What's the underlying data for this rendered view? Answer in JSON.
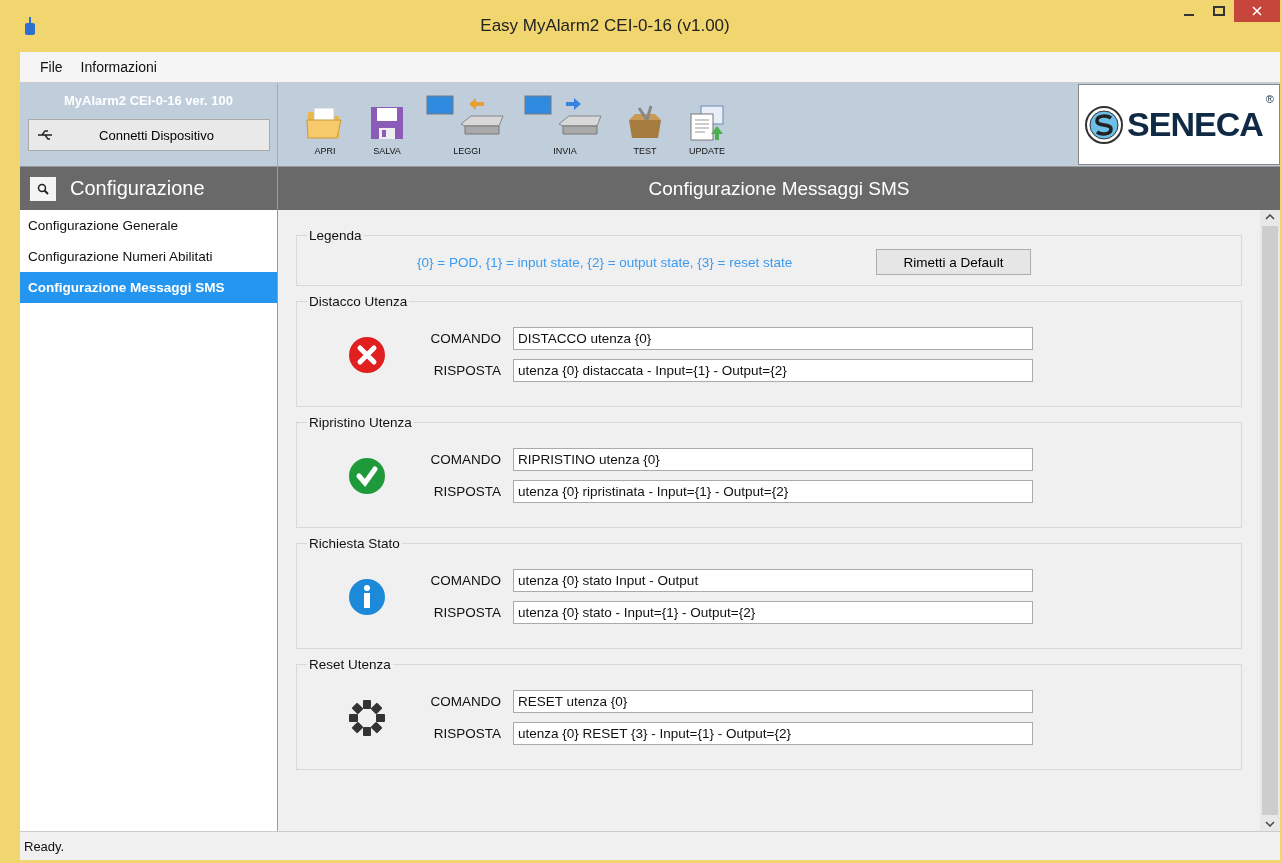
{
  "window": {
    "title": "Easy MyAlarm2 CEI-0-16 (v1.00)"
  },
  "menu": [
    {
      "label": "File"
    },
    {
      "label": "Informazioni"
    }
  ],
  "device": {
    "version": "MyAlarm2 CEI-0-16 ver. 100",
    "connect_button": "Connetti Dispositivo"
  },
  "toolbar": [
    {
      "kind": "open",
      "label": "APRI"
    },
    {
      "kind": "save",
      "label": "SALVA"
    },
    {
      "kind": "read",
      "label": "LEGGI"
    },
    {
      "kind": "send",
      "label": "INVIA"
    },
    {
      "kind": "test",
      "label": "TEST"
    },
    {
      "kind": "update",
      "label": "UPDATE"
    }
  ],
  "logo": {
    "text": "SENECA",
    "mark": "®"
  },
  "sidebar": {
    "title": "Configurazione",
    "items": [
      {
        "label": "Configurazione Generale",
        "selected": false
      },
      {
        "label": "Configurazione Numeri Abilitati",
        "selected": false
      },
      {
        "label": "Configurazione Messaggi SMS",
        "selected": true
      }
    ]
  },
  "page_title": "Configurazione Messaggi SMS",
  "legend": {
    "title": "Legenda",
    "text": "{0} = POD, {1} = input state, {2} = output state, {3} = reset state",
    "button": "Rimetti a Default"
  },
  "groups": [
    {
      "title": "Distacco Utenza",
      "kind": "error",
      "command_label": "COMANDO",
      "command": "DISTACCO utenza {0}",
      "response_label": "RISPOSTA",
      "response": "utenza {0} distaccata - Input={1} - Output={2}"
    },
    {
      "title": "Ripristino Utenza",
      "kind": "ok",
      "command_label": "COMANDO",
      "command": "RIPRISTINO utenza {0}",
      "response_label": "RISPOSTA",
      "response": "utenza {0} ripristinata - Input={1} - Output={2}"
    },
    {
      "title": "Richiesta Stato",
      "kind": "info",
      "command_label": "COMANDO",
      "command": "utenza {0} stato Input - Output",
      "response_label": "RISPOSTA",
      "response": "utenza {0} stato - Input={1} - Output={2}"
    },
    {
      "title": "Reset Utenza",
      "kind": "reset",
      "command_label": "COMANDO",
      "command": "RESET utenza {0}",
      "response_label": "RISPOSTA",
      "response": "utenza {0} RESET {3} - Input={1} - Output={2}"
    }
  ],
  "status_bar": "Ready."
}
